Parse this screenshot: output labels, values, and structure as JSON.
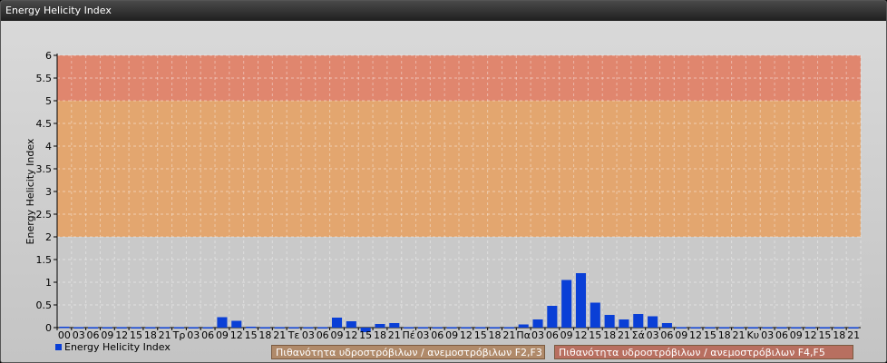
{
  "window": {
    "title": "Energy Helicity Index"
  },
  "chart_data": {
    "type": "bar",
    "title": "",
    "ylabel": "Energy Helicity Index",
    "xlabel": "",
    "ylim": [
      0,
      6
    ],
    "yticks": [
      "0",
      "0.5",
      "1",
      "1.5",
      "2",
      "2.5",
      "3",
      "3.5",
      "4",
      "4.5",
      "5",
      "5.5",
      "6"
    ],
    "grid": true,
    "categories": [
      "00",
      "03",
      "06",
      "09",
      "12",
      "15",
      "18",
      "21",
      "Τρ",
      "03",
      "06",
      "09",
      "12",
      "15",
      "18",
      "21",
      "Τε",
      "03",
      "06",
      "09",
      "12",
      "15",
      "18",
      "21",
      "Πέ",
      "03",
      "06",
      "09",
      "12",
      "15",
      "18",
      "21",
      "Πα",
      "03",
      "06",
      "09",
      "12",
      "15",
      "18",
      "21",
      "Σά",
      "03",
      "06",
      "09",
      "12",
      "15",
      "18",
      "21",
      "Κυ",
      "03",
      "06",
      "09",
      "12",
      "15",
      "18",
      "21"
    ],
    "series": [
      {
        "name": "Energy Helicity Index",
        "color": "#0a3fd6",
        "values": [
          0.02,
          0.01,
          0.01,
          0.01,
          0.01,
          0.01,
          0.01,
          0.01,
          0.01,
          0.01,
          0.01,
          0.23,
          0.15,
          0.02,
          0.01,
          0.01,
          0.01,
          0.01,
          0.01,
          0.22,
          0.14,
          -0.1,
          0.08,
          0.1,
          0.01,
          0.01,
          0.01,
          0.01,
          0.01,
          0.01,
          0.01,
          0.01,
          0.07,
          0.18,
          0.48,
          1.05,
          1.2,
          0.55,
          0.28,
          0.18,
          0.3,
          0.25,
          0.1,
          0.01,
          0.01,
          0.01,
          0.01,
          0.01,
          0.01,
          0.01,
          0.01,
          0.01,
          0.01,
          0.01,
          0.01,
          0.01
        ]
      }
    ],
    "bands": [
      {
        "from": 0,
        "to": 2,
        "color": "#c9c9c9"
      },
      {
        "from": 2,
        "to": 5,
        "color": "#e3a66f",
        "label": "Πιθανότητα υδροστρόβιλων / ανεμοστρόβιλων F2,F3"
      },
      {
        "from": 5,
        "to": 6,
        "color": "#e0866e",
        "label": "Πιθανότητα υδροστρόβιλων / ανεμοστρόβιλων F4,F5"
      }
    ],
    "legend": {
      "placement": "bottom-left",
      "label": "Energy Helicity Index"
    }
  }
}
